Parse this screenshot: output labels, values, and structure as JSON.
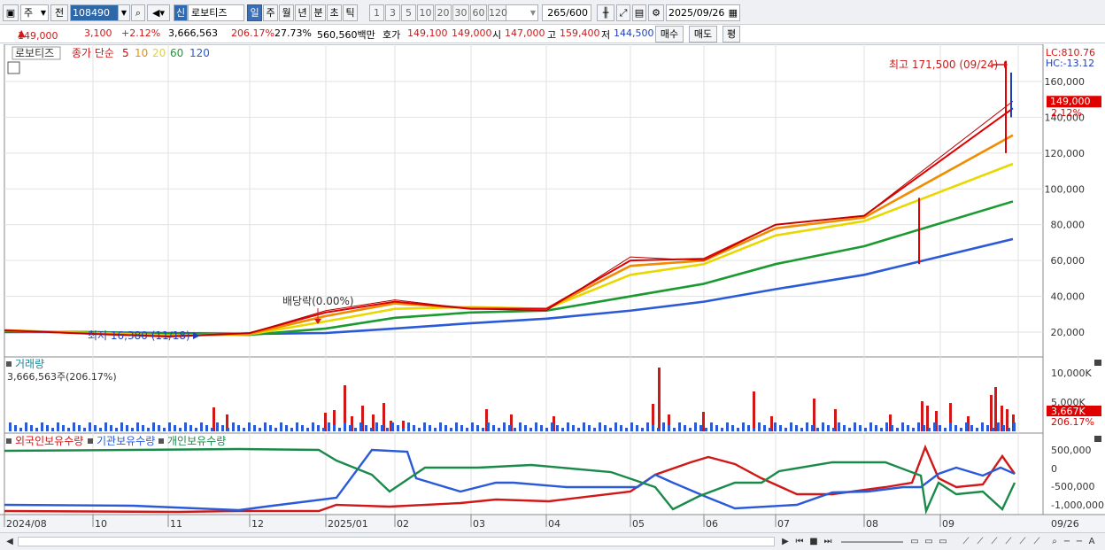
{
  "toolbar": {
    "type_label": "주",
    "all_label": "전",
    "code": "108490",
    "new_label": "신",
    "stock_name": "로보티즈",
    "periods": [
      "일",
      "주",
      "월",
      "년",
      "분",
      "초",
      "틱"
    ],
    "active_period": "일",
    "intervals": [
      "1",
      "3",
      "5",
      "10",
      "20",
      "30",
      "60",
      "120"
    ],
    "count": "265",
    "count_total": "/600",
    "date": "2025/09/26"
  },
  "quote": {
    "price": "149,000",
    "change": "3,100",
    "change_pct": "+2.12%",
    "volume": "3,666,563",
    "vol_ratio": "206.17%",
    "turnover": "27.73%",
    "amount": "560,560백만",
    "bid_label": "호가",
    "bid1": "149,100",
    "bid2": "149,000",
    "open_label": "시",
    "open": "147,000",
    "high_label": "고",
    "high": "159,400",
    "low_label": "저",
    "low": "144,500",
    "buy_label": "매수",
    "sell_label": "매도",
    "eval_label": "평"
  },
  "legend": {
    "name": "로보티즈",
    "close_label": "종가 단순",
    "ma_periods": [
      "5",
      "10",
      "20",
      "60",
      "120"
    ],
    "ma_colors": [
      "#e00000",
      "#f08c00",
      "#e8d800",
      "#1a9a30",
      "#2a5ad8"
    ]
  },
  "price_axis": {
    "ticks": [
      "160,000",
      "140,000",
      "120,000",
      "100,000",
      "80,000",
      "60,000",
      "40,000",
      "20,000"
    ],
    "lc": "LC:810.76",
    "hc": "HC:-13.12",
    "current": "149,000",
    "current_pct": "2.12%"
  },
  "annotations": {
    "high_label": "최고 171,500 (09/24)",
    "low_label": "최저 16,380 (11/18)",
    "dividend_label": "배당락(0.00%)"
  },
  "volume_pane": {
    "title": "거래량",
    "value": "3,666,563주(206.17%)",
    "ticks": [
      "10,000K",
      "5,000K"
    ],
    "current": "3,667K",
    "current_pct": "206.17%"
  },
  "holdings_pane": {
    "labels": [
      "외국인보유수량",
      "기관보유수량",
      "개인보유수량"
    ],
    "colors": [
      "#d01818",
      "#2a5ad8",
      "#1a8a4a"
    ],
    "ticks": [
      "500,000",
      "0",
      "-500,000",
      "-1,000,000"
    ]
  },
  "date_axis": {
    "labels": [
      "2024/08",
      "10",
      "11",
      "12",
      "2025/01",
      "02",
      "03",
      "04",
      "05",
      "06",
      "07",
      "08",
      "09"
    ],
    "end_label": "09/26"
  },
  "chart_data": {
    "type": "candlestick",
    "title": "로보티즈",
    "ylim": [
      16000,
      175000
    ],
    "x": [
      "2024/08",
      "2024/10",
      "2024/11",
      "2024/12",
      "2025/01",
      "2025/02",
      "2025/03",
      "2025/04",
      "2025/05",
      "2025/06",
      "2025/07",
      "2025/08",
      "2025/09"
    ],
    "close_approx": [
      21000,
      19000,
      17500,
      19500,
      32000,
      38000,
      33000,
      32000,
      62000,
      60000,
      80000,
      85000,
      149000
    ],
    "ma": {
      "5": [
        21000,
        19000,
        17500,
        19500,
        31000,
        37000,
        33000,
        33000,
        60000,
        61000,
        80000,
        85000,
        145000
      ],
      "10": [
        21000,
        19200,
        17800,
        19000,
        29000,
        36000,
        33500,
        33000,
        57000,
        60000,
        78000,
        84000,
        130000
      ],
      "20": [
        21000,
        19500,
        18200,
        18800,
        26000,
        33000,
        34000,
        33000,
        52000,
        58000,
        74000,
        82000,
        114000
      ],
      "60": [
        20500,
        20000,
        19000,
        18500,
        22000,
        28000,
        31000,
        32000,
        40000,
        47000,
        58000,
        68000,
        93000
      ],
      "120": [
        20000,
        20000,
        19500,
        19000,
        19500,
        22000,
        25000,
        27500,
        32000,
        37000,
        44000,
        52000,
        72000
      ]
    },
    "high": {
      "value": 171500,
      "date": "09/24"
    },
    "low": {
      "value": 16380,
      "date": "11/18"
    },
    "last": 149000
  }
}
